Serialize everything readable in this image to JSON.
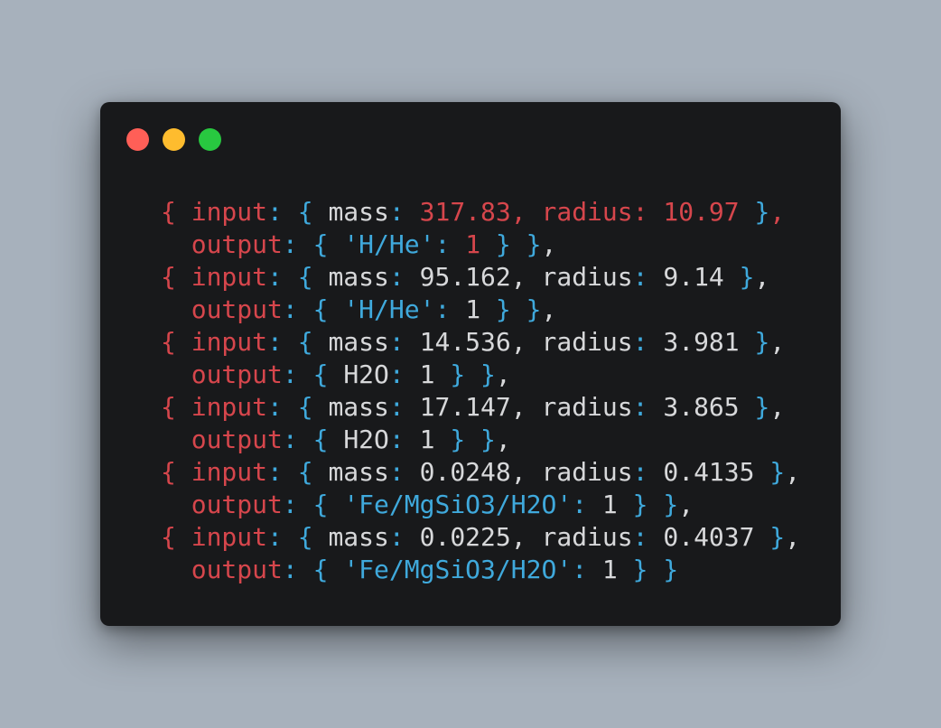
{
  "window": {
    "controls": [
      {
        "name": "close",
        "color": "#ff5f57"
      },
      {
        "name": "minimize",
        "color": "#febc2e"
      },
      {
        "name": "maximize",
        "color": "#28c840"
      }
    ]
  },
  "colors": {
    "background": "#a7b1bc",
    "window": "#18191b",
    "red": "#d6464c",
    "blue": "#3fa9dc",
    "plain": "#d7d8da"
  },
  "code": {
    "lines": [
      [
        {
          "t": "{ ",
          "c": "red"
        },
        {
          "t": "input",
          "c": "red"
        },
        {
          "t": ": ",
          "c": "blue"
        },
        {
          "t": "{ ",
          "c": "blue"
        },
        {
          "t": "mass",
          "c": "plain"
        },
        {
          "t": ": ",
          "c": "blue"
        },
        {
          "t": "317.83",
          "c": "red"
        },
        {
          "t": ", ",
          "c": "red"
        },
        {
          "t": "radius",
          "c": "red"
        },
        {
          "t": ": ",
          "c": "red"
        },
        {
          "t": "10.97",
          "c": "red"
        },
        {
          "t": " }",
          "c": "blue"
        },
        {
          "t": ",",
          "c": "red"
        }
      ],
      [
        {
          "t": "  ",
          "c": "plain"
        },
        {
          "t": "output",
          "c": "red"
        },
        {
          "t": ": ",
          "c": "blue"
        },
        {
          "t": "{ ",
          "c": "blue"
        },
        {
          "t": "'H/He'",
          "c": "blue"
        },
        {
          "t": ": ",
          "c": "blue"
        },
        {
          "t": "1",
          "c": "red"
        },
        {
          "t": " }",
          "c": "blue"
        },
        {
          "t": " }",
          "c": "blue"
        },
        {
          "t": ",",
          "c": "plain"
        }
      ],
      [
        {
          "t": "{ ",
          "c": "red"
        },
        {
          "t": "input",
          "c": "red"
        },
        {
          "t": ": ",
          "c": "blue"
        },
        {
          "t": "{ ",
          "c": "blue"
        },
        {
          "t": "mass",
          "c": "plain"
        },
        {
          "t": ": ",
          "c": "blue"
        },
        {
          "t": "95.162",
          "c": "plain"
        },
        {
          "t": ", ",
          "c": "plain"
        },
        {
          "t": "radius",
          "c": "plain"
        },
        {
          "t": ": ",
          "c": "blue"
        },
        {
          "t": "9.14",
          "c": "plain"
        },
        {
          "t": " }",
          "c": "blue"
        },
        {
          "t": ",",
          "c": "plain"
        }
      ],
      [
        {
          "t": "  ",
          "c": "plain"
        },
        {
          "t": "output",
          "c": "red"
        },
        {
          "t": ": ",
          "c": "blue"
        },
        {
          "t": "{ ",
          "c": "blue"
        },
        {
          "t": "'H/He'",
          "c": "blue"
        },
        {
          "t": ": ",
          "c": "blue"
        },
        {
          "t": "1",
          "c": "plain"
        },
        {
          "t": " }",
          "c": "blue"
        },
        {
          "t": " }",
          "c": "blue"
        },
        {
          "t": ",",
          "c": "plain"
        }
      ],
      [
        {
          "t": "{ ",
          "c": "red"
        },
        {
          "t": "input",
          "c": "red"
        },
        {
          "t": ": ",
          "c": "blue"
        },
        {
          "t": "{ ",
          "c": "blue"
        },
        {
          "t": "mass",
          "c": "plain"
        },
        {
          "t": ": ",
          "c": "blue"
        },
        {
          "t": "14.536",
          "c": "plain"
        },
        {
          "t": ", ",
          "c": "plain"
        },
        {
          "t": "radius",
          "c": "plain"
        },
        {
          "t": ": ",
          "c": "blue"
        },
        {
          "t": "3.981",
          "c": "plain"
        },
        {
          "t": " }",
          "c": "blue"
        },
        {
          "t": ",",
          "c": "plain"
        }
      ],
      [
        {
          "t": "  ",
          "c": "plain"
        },
        {
          "t": "output",
          "c": "red"
        },
        {
          "t": ": ",
          "c": "blue"
        },
        {
          "t": "{ ",
          "c": "blue"
        },
        {
          "t": "H2O",
          "c": "plain"
        },
        {
          "t": ": ",
          "c": "blue"
        },
        {
          "t": "1",
          "c": "plain"
        },
        {
          "t": " }",
          "c": "blue"
        },
        {
          "t": " }",
          "c": "blue"
        },
        {
          "t": ",",
          "c": "plain"
        }
      ],
      [
        {
          "t": "{ ",
          "c": "red"
        },
        {
          "t": "input",
          "c": "red"
        },
        {
          "t": ": ",
          "c": "blue"
        },
        {
          "t": "{ ",
          "c": "blue"
        },
        {
          "t": "mass",
          "c": "plain"
        },
        {
          "t": ": ",
          "c": "blue"
        },
        {
          "t": "17.147",
          "c": "plain"
        },
        {
          "t": ", ",
          "c": "plain"
        },
        {
          "t": "radius",
          "c": "plain"
        },
        {
          "t": ": ",
          "c": "blue"
        },
        {
          "t": "3.865",
          "c": "plain"
        },
        {
          "t": " }",
          "c": "blue"
        },
        {
          "t": ",",
          "c": "plain"
        }
      ],
      [
        {
          "t": "  ",
          "c": "plain"
        },
        {
          "t": "output",
          "c": "red"
        },
        {
          "t": ": ",
          "c": "blue"
        },
        {
          "t": "{ ",
          "c": "blue"
        },
        {
          "t": "H2O",
          "c": "plain"
        },
        {
          "t": ": ",
          "c": "blue"
        },
        {
          "t": "1",
          "c": "plain"
        },
        {
          "t": " }",
          "c": "blue"
        },
        {
          "t": " }",
          "c": "blue"
        },
        {
          "t": ",",
          "c": "plain"
        }
      ],
      [
        {
          "t": "{ ",
          "c": "red"
        },
        {
          "t": "input",
          "c": "red"
        },
        {
          "t": ": ",
          "c": "blue"
        },
        {
          "t": "{ ",
          "c": "blue"
        },
        {
          "t": "mass",
          "c": "plain"
        },
        {
          "t": ": ",
          "c": "blue"
        },
        {
          "t": "0.0248",
          "c": "plain"
        },
        {
          "t": ", ",
          "c": "plain"
        },
        {
          "t": "radius",
          "c": "plain"
        },
        {
          "t": ": ",
          "c": "blue"
        },
        {
          "t": "0.4135",
          "c": "plain"
        },
        {
          "t": " }",
          "c": "blue"
        },
        {
          "t": ",",
          "c": "plain"
        }
      ],
      [
        {
          "t": "  ",
          "c": "plain"
        },
        {
          "t": "output",
          "c": "red"
        },
        {
          "t": ": ",
          "c": "blue"
        },
        {
          "t": "{ ",
          "c": "blue"
        },
        {
          "t": "'Fe/MgSiO3/H2O'",
          "c": "blue"
        },
        {
          "t": ": ",
          "c": "blue"
        },
        {
          "t": "1",
          "c": "plain"
        },
        {
          "t": " }",
          "c": "blue"
        },
        {
          "t": " }",
          "c": "blue"
        },
        {
          "t": ",",
          "c": "plain"
        }
      ],
      [
        {
          "t": "{ ",
          "c": "red"
        },
        {
          "t": "input",
          "c": "red"
        },
        {
          "t": ": ",
          "c": "blue"
        },
        {
          "t": "{ ",
          "c": "blue"
        },
        {
          "t": "mass",
          "c": "plain"
        },
        {
          "t": ": ",
          "c": "blue"
        },
        {
          "t": "0.0225",
          "c": "plain"
        },
        {
          "t": ", ",
          "c": "plain"
        },
        {
          "t": "radius",
          "c": "plain"
        },
        {
          "t": ": ",
          "c": "blue"
        },
        {
          "t": "0.4037",
          "c": "plain"
        },
        {
          "t": " }",
          "c": "blue"
        },
        {
          "t": ",",
          "c": "plain"
        }
      ],
      [
        {
          "t": "  ",
          "c": "plain"
        },
        {
          "t": "output",
          "c": "red"
        },
        {
          "t": ": ",
          "c": "blue"
        },
        {
          "t": "{ ",
          "c": "blue"
        },
        {
          "t": "'Fe/MgSiO3/H2O'",
          "c": "blue"
        },
        {
          "t": ": ",
          "c": "blue"
        },
        {
          "t": "1",
          "c": "plain"
        },
        {
          "t": " }",
          "c": "blue"
        },
        {
          "t": " }",
          "c": "blue"
        }
      ]
    ]
  }
}
